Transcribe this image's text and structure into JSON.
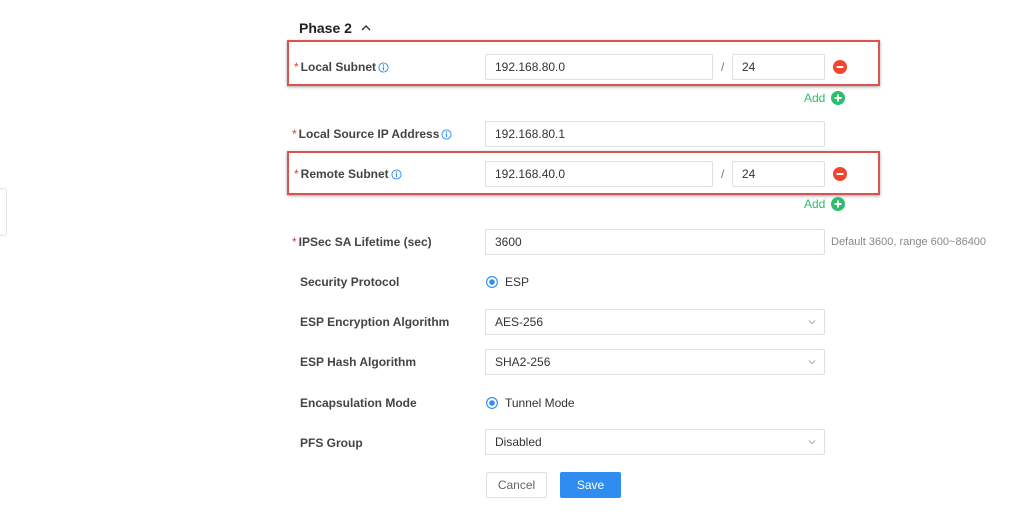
{
  "section": {
    "title": "Phase 2"
  },
  "local_subnet": {
    "label": "Local Subnet",
    "ip": "192.168.80.0",
    "separator": "/",
    "mask": "24",
    "add_label": "Add"
  },
  "local_source_ip": {
    "label": "Local Source IP Address",
    "value": "192.168.80.1"
  },
  "remote_subnet": {
    "label": "Remote Subnet",
    "ip": "192.168.40.0",
    "separator": "/",
    "mask": "24",
    "add_label": "Add"
  },
  "ipsec_sa_lifetime": {
    "label": "IPSec SA Lifetime (sec)",
    "value": "3600",
    "hint": "Default 3600, range 600~86400"
  },
  "security_protocol": {
    "label": "Security Protocol",
    "selected": "ESP"
  },
  "esp_encryption": {
    "label": "ESP Encryption Algorithm",
    "value": "AES-256"
  },
  "esp_hash": {
    "label": "ESP Hash Algorithm",
    "value": "SHA2-256"
  },
  "encapsulation_mode": {
    "label": "Encapsulation Mode",
    "selected": "Tunnel Mode"
  },
  "pfs_group": {
    "label": "PFS Group",
    "value": "Disabled"
  },
  "buttons": {
    "cancel": "Cancel",
    "save": "Save"
  },
  "colors": {
    "required": "#e53935",
    "info": "#2f8cf0",
    "add": "#2dbe6c",
    "remove": "#f0462e",
    "highlight": "#d9534f",
    "primary": "#2f8cf0"
  },
  "icons": {
    "section_toggle": "chevron-up-icon",
    "info": "info-circle-icon",
    "remove": "minus-circle-icon",
    "add": "plus-circle-icon",
    "dropdown": "chevron-down-icon"
  }
}
